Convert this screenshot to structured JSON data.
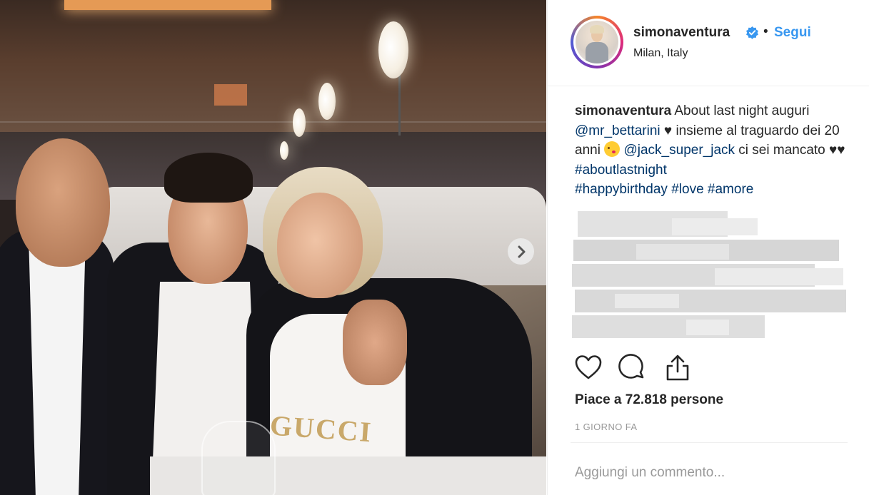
{
  "post": {
    "header": {
      "username": "simonaventura",
      "separator": "•",
      "follow_label": "Segui",
      "location": "Milan, Italy"
    },
    "caption": {
      "username": "simonaventura",
      "text_1": " About last night auguri ",
      "mention_1": "@mr_bettarini",
      "text_2": " ♥ insieme al traguardo dei 20 anni ",
      "mention_2": "@jack_super_jack",
      "text_3": " ci sei mancato ♥♥ ",
      "hashtag_1": "#aboutlastnight",
      "hashtag_2": "#happybirthday",
      "hashtag_3": "#love",
      "hashtag_4": "#amore"
    },
    "photo_text": "GUCCI",
    "likes": "Piace a 72.818 persone",
    "timestamp": "1 GIORNO FA",
    "comment_placeholder": "Aggiungi un commento..."
  },
  "icons": {
    "verified": "verified-badge-icon",
    "next": "chevron-right-icon",
    "like": "heart-icon",
    "comment": "comment-bubble-icon",
    "share": "share-icon"
  },
  "colors": {
    "link": "#003569",
    "follow": "#3897f0",
    "verified": "#3897f0",
    "muted": "#999999"
  }
}
